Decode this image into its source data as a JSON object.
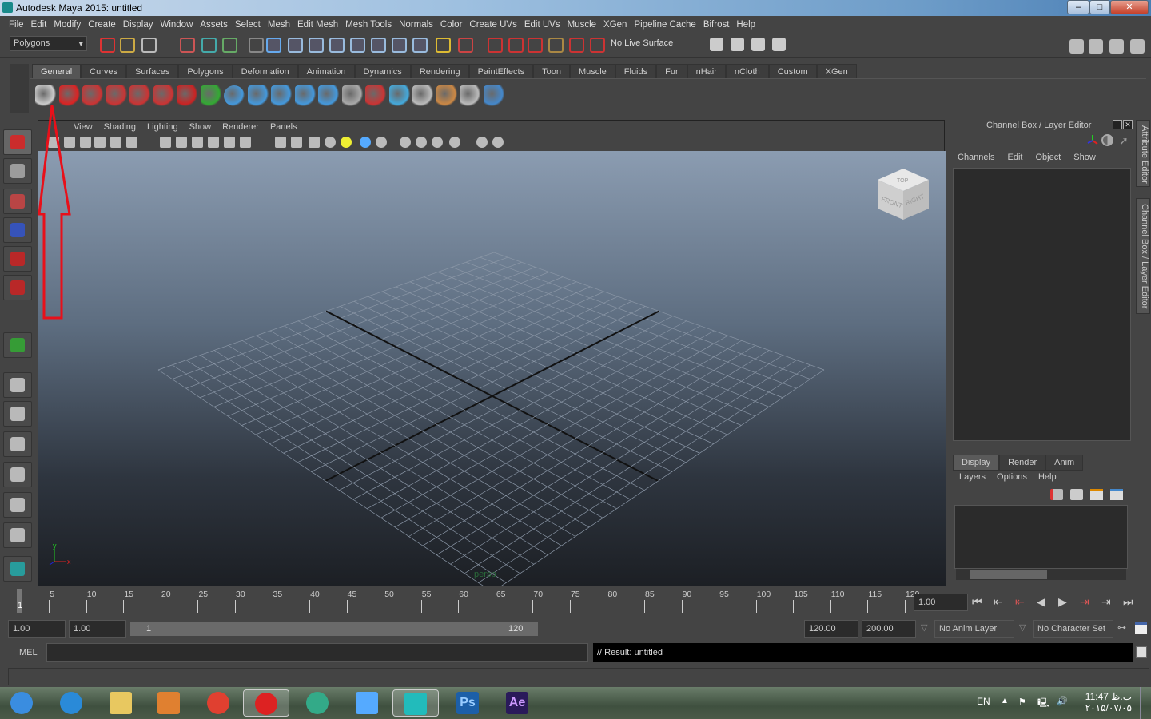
{
  "window": {
    "title": "Autodesk Maya 2015: untitled",
    "controls": [
      "minimize",
      "maximize",
      "close"
    ]
  },
  "menubar": [
    "File",
    "Edit",
    "Modify",
    "Create",
    "Display",
    "Window",
    "Assets",
    "Select",
    "Mesh",
    "Edit Mesh",
    "Mesh Tools",
    "Normals",
    "Color",
    "Create UVs",
    "Edit UVs",
    "Muscle",
    "XGen",
    "Pipeline Cache",
    "Bifrost",
    "Help"
  ],
  "status": {
    "menuset": "Polygons",
    "live_surface": "No Live Surface"
  },
  "shelf": {
    "tabs": [
      "General",
      "Curves",
      "Surfaces",
      "Polygons",
      "Deformation",
      "Animation",
      "Dynamics",
      "Rendering",
      "PaintEffects",
      "Toon",
      "Muscle",
      "Fluids",
      "Fur",
      "nHair",
      "nCloth",
      "Custom",
      "XGen"
    ],
    "active": "General",
    "icons": [
      "film-reel-icon",
      "help-icon",
      "muscle-icon",
      "muscle-move-icon",
      "muscle-paint-icon",
      "muscle-weight-icon",
      "magnet-icon",
      "arrow-curve-icon",
      "sphere-light-icon",
      "joint-icon",
      "ik-joint-icon",
      "ik-handle-icon",
      "skin-icon",
      "hypergraph-icon",
      "render-icon",
      "render-cube-icon",
      "render-box-icon",
      "paint-icon",
      "lattice-icon",
      "manipulator-icon"
    ]
  },
  "viewport": {
    "menu": [
      "View",
      "Shading",
      "Lighting",
      "Show",
      "Renderer",
      "Panels"
    ],
    "camera_label": "persp",
    "viewcube": {
      "top": "TOP",
      "front": "FRONT",
      "right": "RIGHT"
    },
    "axis": {
      "x": "x",
      "y": "y"
    }
  },
  "annotation": {
    "color": "#e8101a",
    "shape": "arrow-up"
  },
  "channel_box": {
    "title": "Channel Box / Layer Editor",
    "menu": [
      "Channels",
      "Edit",
      "Object",
      "Show"
    ]
  },
  "layer_editor": {
    "tabs": [
      "Display",
      "Render",
      "Anim"
    ],
    "active": "Display",
    "menu": [
      "Layers",
      "Options",
      "Help"
    ]
  },
  "side_tabs": [
    "Attribute Editor",
    "Channel Box / Layer Editor"
  ],
  "timeline": {
    "ticks": [
      5,
      10,
      15,
      20,
      25,
      30,
      35,
      40,
      45,
      50,
      55,
      60,
      65,
      70,
      75,
      80,
      85,
      90,
      95,
      100,
      105,
      110,
      115,
      120
    ],
    "current": "1",
    "current_field": "1.00",
    "playback": [
      "go-to-start",
      "step-back-key",
      "step-back-frame-key",
      "play-backward",
      "play-forward",
      "step-forward-key",
      "step-forward",
      "go-to-end"
    ]
  },
  "range": {
    "start": "1.00",
    "playback_start": "1.00",
    "slider_start": "1",
    "slider_end": "120",
    "playback_end": "120.00",
    "end": "200.00",
    "anim_layer": "No Anim Layer",
    "character_set": "No Character Set"
  },
  "command": {
    "lang": "MEL",
    "result": "// Result: untitled"
  },
  "taskbar": {
    "apps": [
      "start",
      "internet-explorer",
      "file-explorer",
      "media-player",
      "chrome",
      "opera",
      "download-manager",
      "xsplit",
      "maya",
      "photoshop",
      "after-effects"
    ],
    "ps": "Ps",
    "ae": "Ae",
    "lang": "EN",
    "time": "11:47 ب.ظ",
    "date": "۲۰۱۵/۰۷/۰۵"
  }
}
